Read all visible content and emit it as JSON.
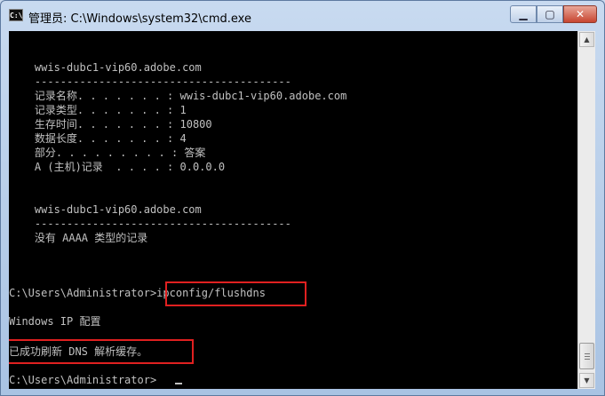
{
  "window": {
    "title": "管理员: C:\\Windows\\system32\\cmd.exe",
    "icon": "cmd-icon"
  },
  "controls": {
    "minimize": "▁",
    "maximize": "▢",
    "close": "✕"
  },
  "console_lines": [
    "    wwis-dubc1-vip60.adobe.com",
    "    ----------------------------------------",
    "    记录名称. . . . . . . : wwis-dubc1-vip60.adobe.com",
    "    记录类型. . . . . . . : 1",
    "    生存时间. . . . . . . : 10800",
    "    数据长度. . . . . . . : 4",
    "    部分. . . . . . . . . : 答案",
    "    A (主机)记录  . . . . : 0.0.0.0",
    "    wwis-dubc1-vip60.adobe.com",
    "    ----------------------------------------",
    "    没有 AAAA 类型的记录",
    "C:\\Users\\Administrator>ipconfig/flushdns",
    "Windows IP 配置",
    "已成功刷新 DNS 解析缓存。",
    "C:\\Users\\Administrator>"
  ]
}
